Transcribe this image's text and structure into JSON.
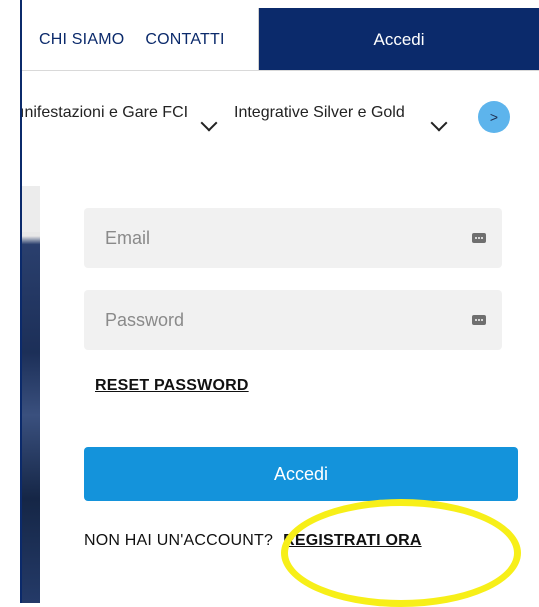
{
  "topbar": {
    "links": [
      "CHI SIAMO",
      "CONTATTI"
    ],
    "accedi_label": "Accedi"
  },
  "nav": {
    "items": [
      {
        "label": "ınifestazioni e Gare FCI"
      },
      {
        "label": "Integrative Silver e Gold"
      }
    ],
    "next_label": ">"
  },
  "login": {
    "email_placeholder": "Email",
    "password_placeholder": "Password",
    "reset_label": "RESET PASSWORD",
    "submit_label": "Accedi",
    "no_account_text": "NON HAI UN'ACCOUNT?",
    "register_label": "REGISTRATI ORA"
  },
  "colors": {
    "navy": "#0b2a6b",
    "primary_button": "#1493db",
    "next_button": "#5db4ec",
    "highlight": "#f7ef18"
  },
  "icons": {
    "chevron": "chevron-down-icon",
    "field_key": "keyboard-icon"
  }
}
